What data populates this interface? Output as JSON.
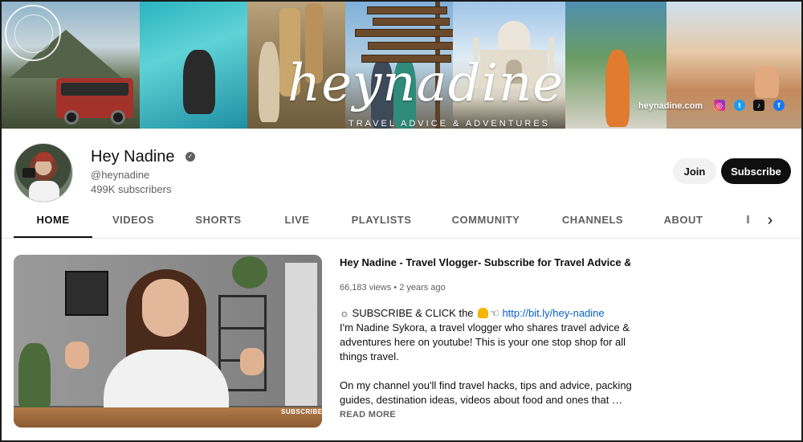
{
  "banner": {
    "logo_text": "heynadine",
    "tagline": "TRAVEL ADVICE & ADVENTURES",
    "website": "heynadine.com",
    "social_icons": [
      "instagram-icon",
      "twitter-icon",
      "tiktok-icon",
      "facebook-icon"
    ]
  },
  "channel": {
    "name": "Hey Nadine",
    "handle": "@heynadine",
    "subscribers": "499K subscribers",
    "verified_icon": "verified-check-icon"
  },
  "actions": {
    "join_label": "Join",
    "subscribe_label": "Subscribe"
  },
  "tabs": [
    {
      "label": "HOME",
      "active": true
    },
    {
      "label": "VIDEOS",
      "active": false
    },
    {
      "label": "SHORTS",
      "active": false
    },
    {
      "label": "LIVE",
      "active": false
    },
    {
      "label": "PLAYLISTS",
      "active": false
    },
    {
      "label": "COMMUNITY",
      "active": false
    },
    {
      "label": "CHANNELS",
      "active": false
    },
    {
      "label": "ABOUT",
      "active": false
    }
  ],
  "featured": {
    "title": "Hey Nadine - Travel Vlogger- Subscribe for Travel Advice & Ad…",
    "views": "66,183 views",
    "age": "2 years ago",
    "player_overlay": "SUBSCRIBE",
    "desc_line1_prefix": "☼ SUBSCRIBE & CLICK the",
    "desc_line1_arrow": "☜",
    "desc_link": "http://bit.ly/hey-nadine",
    "desc_lines": [
      "I'm Nadine Sykora, a travel vlogger who shares travel advice &",
      "adventures here on youtube! This is your one stop shop for all",
      "things travel."
    ],
    "desc_lines_2": [
      "On my channel you'll find travel hacks, tips and advice, packing",
      "guides, destination ideas, videos about food and ones that …"
    ],
    "read_more": "READ MORE"
  },
  "colors": {
    "subscribe_bg": "#0f0f0f",
    "link": "#065fd4",
    "secondary_text": "#606060"
  }
}
